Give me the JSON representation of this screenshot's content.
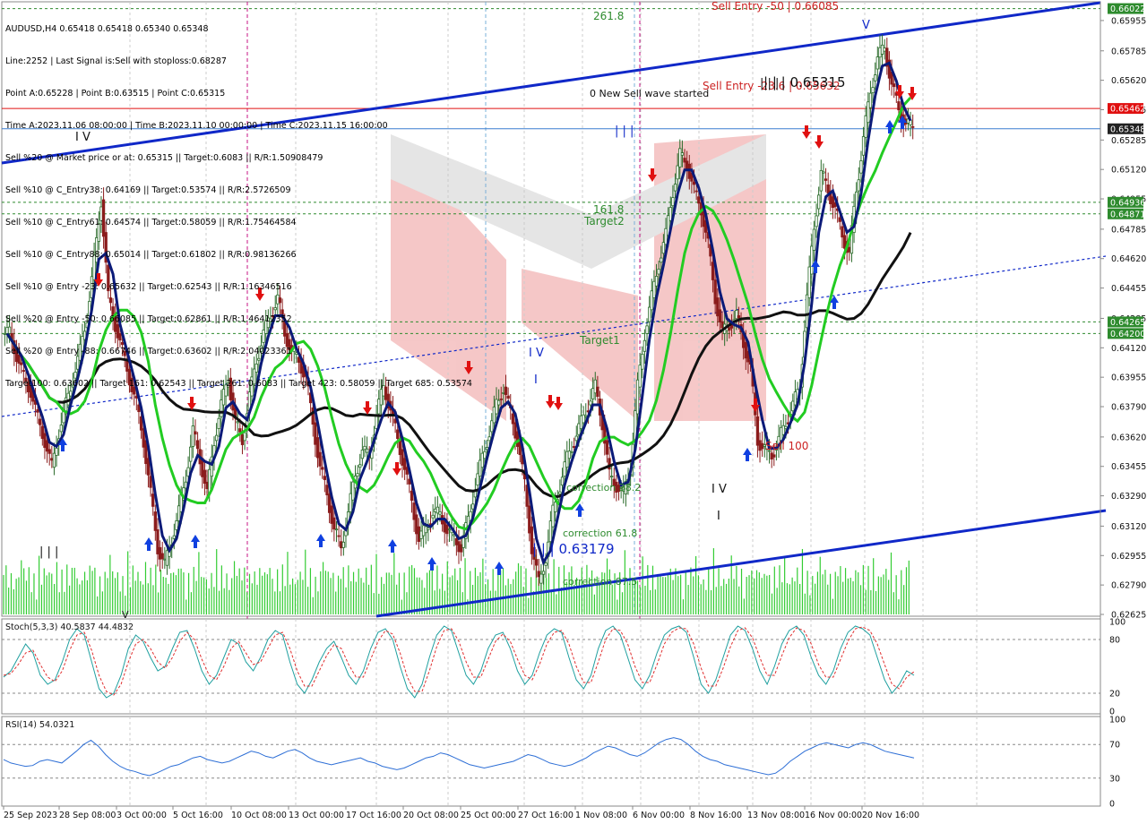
{
  "symbol": "AUDUSD,H4",
  "ohlc": "0.65418 0.65418 0.65340 0.65348",
  "info_lines": [
    "Line:2252 | Last Signal is:Sell with stoploss:0.68287",
    "Point A:0.65228 | Point B:0.63515 | Point C:0.65315",
    "Time A:2023.11.06 08:00:00 | Time B:2023.11.10 00:00:00 | Time C:2023.11.15 16:00:00",
    "Sell %20 @ Market price or at: 0.65315 || Target:0.6083 || R/R:1.50908479",
    "Sell %10 @ C_Entry38: 0.64169 || Target:0.53574 || R/R:2.5726509",
    "Sell %10 @ C_Entry61: 0.64574 || Target:0.58059 || R/R:1.75464584",
    "Sell %10 @ C_Entry88: 0.65014 || Target:0.61802 || R/R:0.98136266",
    "Sell %10 @ Entry -23: 0.65632 || Target:0.62543 || R/R:1.16346516",
    "Sell %20 @ Entry -50: 0.66085 || Target:0.62861 || R/R:1.46412352",
    "Sell %20 @ Entry -88: 0.66746 || Target:0.63602 || R/R:2.04023361",
    "Target100: 0.63602 || Target 161: 0.62543 || Target 261: 0.6083 || Target 423: 0.58059 || Target 685: 0.53574"
  ],
  "colors": {
    "bull": "#2a6b2a",
    "bear": "#8b1c1c",
    "ma_fast": "#0b1a78",
    "ma_mid": "#22cc22",
    "ma_slow": "#111111",
    "channel": "#1028c8",
    "green_line": "#2e8b2e",
    "red_line": "#e01010",
    "blue_line": "#3a7fd0",
    "stoch_main": "#20a0a0",
    "stoch_signal": "#e03030",
    "rsi": "#2e6fd6",
    "volume": "#33cc33",
    "watermark": "#ee9a9a"
  },
  "labels": {
    "fib_261": "261.8",
    "fib_161": "161.8",
    "target2": "Target2",
    "target1": "Target1",
    "sell_entry_50": "Sell Entry -50 | 0.66085",
    "sell_entry_23": "Sell Entry -23.6 | 0.65632",
    "wave_value": "| | | 0.65315",
    "new_sell_wave": "0 New Sell wave started",
    "sell_100": "Sell 100",
    "corr_38": "correction 38.2",
    "corr_61": "correction 61.8",
    "corr_87": "correction 87.5",
    "wave_low": "| | | 0.63179",
    "wave_iii_1": "| | |",
    "wave_iii_2": "| | |",
    "wave_iii_3": "| | |",
    "wave_iv": "I V",
    "wave_iv_2": "I V",
    "wave_v": "V",
    "wave_v_2": "I V",
    "wave_i": "I",
    "wave_i_2": "I",
    "wave_v_low": "V"
  },
  "price_axis": {
    "ticks": [
      "0.65955",
      "0.65785",
      "0.65620",
      "0.65455",
      "0.65285",
      "0.65120",
      "0.64955",
      "0.64785",
      "0.64620",
      "0.64455",
      "0.64285",
      "0.64120",
      "0.63955",
      "0.63790",
      "0.63620",
      "0.63455",
      "0.63290",
      "0.63120",
      "0.62955",
      "0.62790",
      "0.62625"
    ],
    "levels": [
      {
        "value": "0.66022",
        "color": "#2e8b2e"
      },
      {
        "value": "0.65462",
        "color": "#e01010"
      },
      {
        "value": "0.65348",
        "color": "#222222"
      },
      {
        "value": "0.64936",
        "color": "#2e8b2e"
      },
      {
        "value": "0.64871",
        "color": "#2e8b2e"
      },
      {
        "value": "0.64265",
        "color": "#2e8b2e"
      },
      {
        "value": "0.64200",
        "color": "#2e8b2e"
      }
    ]
  },
  "time_axis": [
    "25 Sep 2023",
    "28 Sep 08:00",
    "3 Oct 00:00",
    "5 Oct 16:00",
    "10 Oct 08:00",
    "13 Oct 00:00",
    "17 Oct 16:00",
    "20 Oct 08:00",
    "25 Oct 00:00",
    "27 Oct 16:00",
    "1 Nov 08:00",
    "6 Nov 00:00",
    "8 Nov 16:00",
    "13 Nov 08:00",
    "16 Nov 00:00",
    "20 Nov 16:00"
  ],
  "stoch": {
    "label": "Stoch(5,3,3) 40.5837 44.4832",
    "ticks": [
      "100",
      "80",
      "20",
      "0"
    ],
    "main": [
      38,
      45,
      60,
      75,
      65,
      40,
      30,
      35,
      55,
      80,
      92,
      85,
      55,
      25,
      15,
      20,
      40,
      70,
      85,
      78,
      60,
      45,
      50,
      70,
      88,
      90,
      70,
      45,
      30,
      40,
      60,
      80,
      75,
      55,
      45,
      60,
      80,
      90,
      85,
      55,
      30,
      20,
      35,
      55,
      70,
      78,
      60,
      40,
      30,
      45,
      70,
      88,
      92,
      80,
      50,
      25,
      15,
      30,
      60,
      85,
      95,
      90,
      65,
      40,
      30,
      45,
      70,
      85,
      88,
      70,
      45,
      30,
      40,
      65,
      85,
      92,
      88,
      60,
      35,
      25,
      40,
      70,
      90,
      95,
      85,
      60,
      35,
      25,
      40,
      65,
      85,
      92,
      95,
      88,
      60,
      30,
      20,
      35,
      60,
      85,
      95,
      90,
      70,
      45,
      30,
      50,
      75,
      90,
      95,
      85,
      60,
      40,
      30,
      45,
      70,
      88,
      95,
      92,
      85,
      60,
      35,
      20,
      30,
      45,
      40
    ],
    "signal": [
      40,
      42,
      52,
      65,
      68,
      52,
      38,
      33,
      45,
      68,
      85,
      88,
      68,
      40,
      22,
      18,
      30,
      55,
      75,
      80,
      70,
      55,
      48,
      60,
      78,
      88,
      80,
      58,
      40,
      35,
      50,
      70,
      78,
      65,
      52,
      55,
      70,
      85,
      88,
      70,
      45,
      28,
      28,
      45,
      62,
      74,
      70,
      52,
      38,
      38,
      58,
      78,
      90,
      86,
      65,
      38,
      22,
      22,
      45,
      72,
      90,
      92,
      78,
      55,
      38,
      38,
      58,
      78,
      86,
      78,
      58,
      40,
      35,
      52,
      75,
      88,
      90,
      75,
      50,
      32,
      32,
      55,
      80,
      92,
      90,
      75,
      50,
      32,
      32,
      52,
      75,
      88,
      93,
      92,
      75,
      48,
      28,
      28,
      48,
      72,
      90,
      93,
      82,
      60,
      40,
      40,
      62,
      82,
      93,
      90,
      75,
      52,
      38,
      38,
      58,
      78,
      92,
      94,
      90,
      75,
      52,
      30,
      25,
      38,
      44
    ]
  },
  "rsi": {
    "label": "RSI(14) 54.0321",
    "ticks": [
      "100",
      "70",
      "30",
      "0"
    ],
    "values": [
      52,
      48,
      46,
      44,
      45,
      50,
      52,
      50,
      48,
      55,
      62,
      70,
      75,
      68,
      58,
      50,
      44,
      40,
      38,
      35,
      33,
      36,
      40,
      44,
      46,
      50,
      54,
      56,
      52,
      50,
      48,
      50,
      54,
      58,
      62,
      60,
      56,
      54,
      58,
      62,
      64,
      60,
      54,
      50,
      48,
      46,
      48,
      50,
      52,
      54,
      50,
      48,
      44,
      42,
      40,
      42,
      46,
      50,
      54,
      56,
      60,
      58,
      54,
      50,
      46,
      44,
      42,
      44,
      46,
      48,
      50,
      54,
      58,
      56,
      52,
      48,
      46,
      44,
      46,
      50,
      54,
      60,
      64,
      68,
      66,
      62,
      58,
      56,
      60,
      66,
      72,
      76,
      78,
      76,
      70,
      62,
      56,
      52,
      50,
      46,
      44,
      42,
      40,
      38,
      36,
      34,
      36,
      42,
      50,
      56,
      62,
      66,
      70,
      72,
      70,
      68,
      66,
      70,
      72,
      70,
      66,
      62,
      60,
      58,
      56,
      54
    ]
  },
  "chart_data": {
    "type": "candlestick",
    "symbol": "AUDUSD",
    "timeframe": "H4",
    "ylim": [
      0.62625,
      0.6605
    ],
    "x_start": "25 Sep 2023",
    "close": [
      0.642,
      0.6408,
      0.6395,
      0.6388,
      0.6372,
      0.636,
      0.6345,
      0.6365,
      0.638,
      0.6395,
      0.641,
      0.643,
      0.646,
      0.6495,
      0.644,
      0.6425,
      0.641,
      0.6395,
      0.638,
      0.636,
      0.633,
      0.63,
      0.629,
      0.6305,
      0.632,
      0.634,
      0.6365,
      0.635,
      0.633,
      0.636,
      0.638,
      0.6395,
      0.637,
      0.636,
      0.6385,
      0.6405,
      0.642,
      0.643,
      0.644,
      0.642,
      0.641,
      0.6405,
      0.6395,
      0.637,
      0.6345,
      0.633,
      0.631,
      0.63,
      0.632,
      0.634,
      0.6355,
      0.635,
      0.6375,
      0.639,
      0.6378,
      0.636,
      0.6345,
      0.6325,
      0.6305,
      0.631,
      0.632,
      0.6318,
      0.631,
      0.6305,
      0.63,
      0.6315,
      0.6335,
      0.635,
      0.6365,
      0.638,
      0.639,
      0.6375,
      0.636,
      0.6335,
      0.63,
      0.628,
      0.6295,
      0.632,
      0.6335,
      0.635,
      0.636,
      0.637,
      0.638,
      0.639,
      0.637,
      0.634,
      0.6335,
      0.633,
      0.6345,
      0.639,
      0.642,
      0.644,
      0.646,
      0.6475,
      0.65,
      0.652,
      0.6515,
      0.65,
      0.649,
      0.647,
      0.644,
      0.642,
      0.6425,
      0.643,
      0.6415,
      0.64,
      0.636,
      0.6355,
      0.6352,
      0.636,
      0.637,
      0.638,
      0.639,
      0.644,
      0.648,
      0.651,
      0.65,
      0.649,
      0.6475,
      0.6465,
      0.65,
      0.653,
      0.6555,
      0.6575,
      0.658,
      0.656,
      0.6545,
      0.6538,
      0.6535
    ]
  }
}
